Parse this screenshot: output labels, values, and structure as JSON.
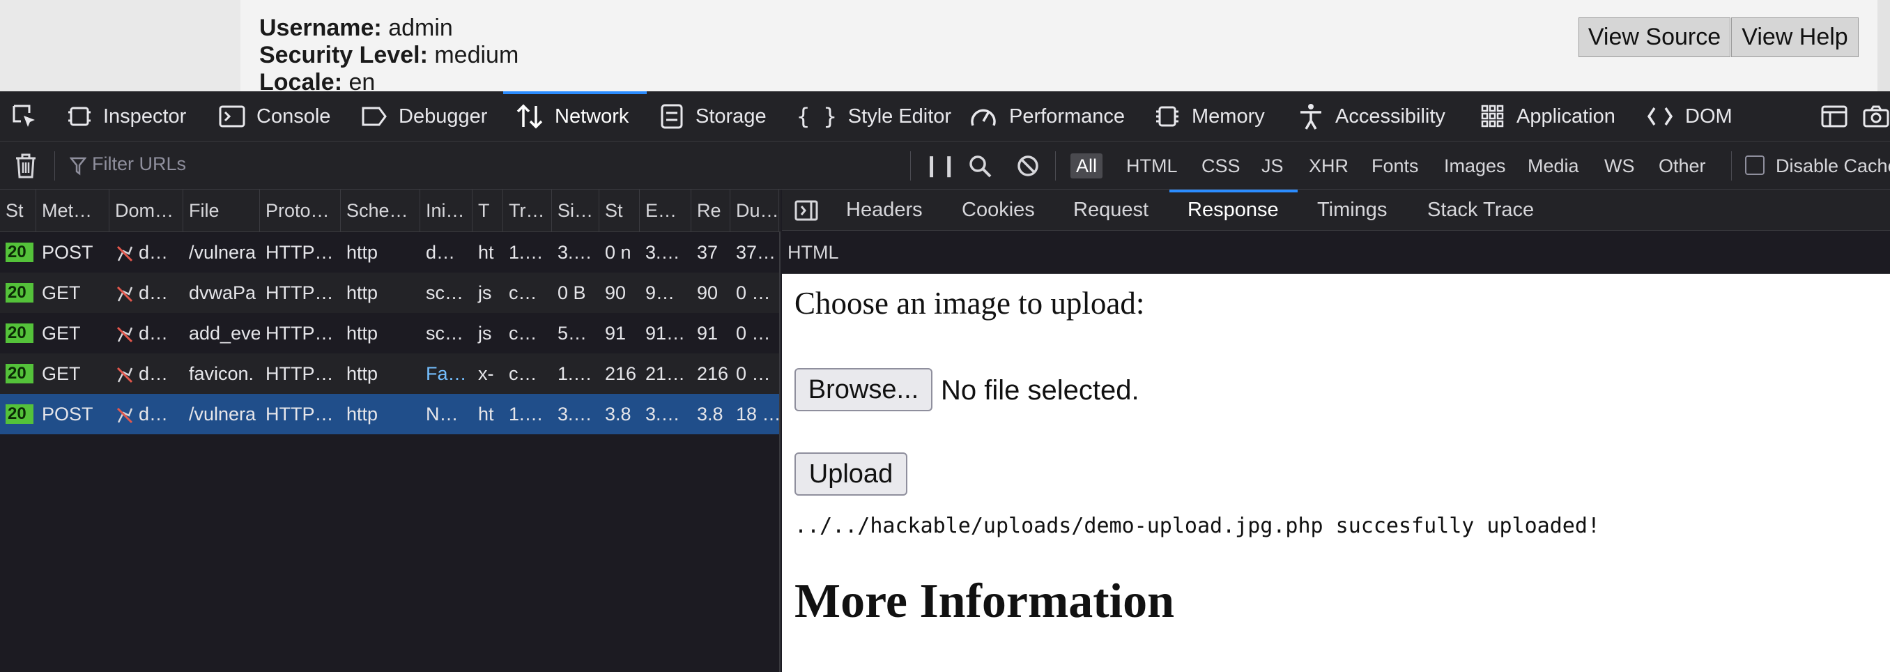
{
  "page": {
    "username_label": "Username:",
    "username_value": "admin",
    "security_label": "Security Level:",
    "security_value": "medium",
    "locale_label": "Locale:",
    "locale_value": "en",
    "view_source": "View Source",
    "view_help": "View Help"
  },
  "toolbar": {
    "tabs": [
      "Inspector",
      "Console",
      "Debugger",
      "Network",
      "Storage",
      "Style Editor",
      "Performance",
      "Memory",
      "Accessibility",
      "Application",
      "DOM"
    ],
    "active": "Network"
  },
  "filter": {
    "placeholder": "Filter URLs",
    "types": [
      "All",
      "HTML",
      "CSS",
      "JS",
      "XHR",
      "Fonts",
      "Images",
      "Media",
      "WS",
      "Other"
    ],
    "active_type": "All",
    "disable_cache": "Disable Cache"
  },
  "table": {
    "headers": [
      "St",
      "Met…",
      "Dom…",
      "File",
      "Proto…",
      "Sche…",
      "Ini…",
      "T",
      "Tr…",
      "Si…",
      "St",
      "E…",
      "Re",
      "Du…"
    ],
    "rows": [
      [
        "20",
        "POST",
        "d…",
        "/vulnera",
        "HTTP…",
        "http",
        "d…",
        "ht",
        "1.…",
        "3.…",
        "0 n",
        "3.…",
        "37",
        "37…"
      ],
      [
        "20",
        "GET",
        "d…",
        "dvwaPa",
        "HTTP…",
        "http",
        "sc…",
        "js",
        "c…",
        "0 B",
        "90",
        "9…",
        "90",
        "0 …"
      ],
      [
        "20",
        "GET",
        "d…",
        "add_eve",
        "HTTP…",
        "http",
        "sc…",
        "js",
        "c…",
        "5…",
        "91",
        "91…",
        "91",
        "0 …"
      ],
      [
        "20",
        "GET",
        "d…",
        "favicon.",
        "HTTP…",
        "http",
        "Fa…",
        "x-",
        "c…",
        "1.…",
        "216",
        "21…",
        "216",
        "0 …"
      ],
      [
        "20",
        "POST",
        "d…",
        "/vulnera",
        "HTTP…",
        "http",
        "N…",
        "ht",
        "1.…",
        "3.…",
        "3.8",
        "3.…",
        "3.8",
        "18 …"
      ]
    ],
    "selected_row": 4
  },
  "details": {
    "tabs": [
      "Headers",
      "Cookies",
      "Request",
      "Response",
      "Timings",
      "Stack Trace"
    ],
    "active": "Response",
    "response_type": "HTML",
    "preview": {
      "prompt": "Choose an image to upload:",
      "browse": "Browse...",
      "no_file": "No file selected.",
      "upload": "Upload",
      "message": "../../hackable/uploads/demo-upload.jpg.php succesfully uploaded!",
      "heading": "More Information"
    }
  },
  "colors": {
    "accent": "#2b8cff",
    "status_ok": "#54c23a",
    "selected_row": "#204e8a",
    "link": "#75bfff"
  }
}
